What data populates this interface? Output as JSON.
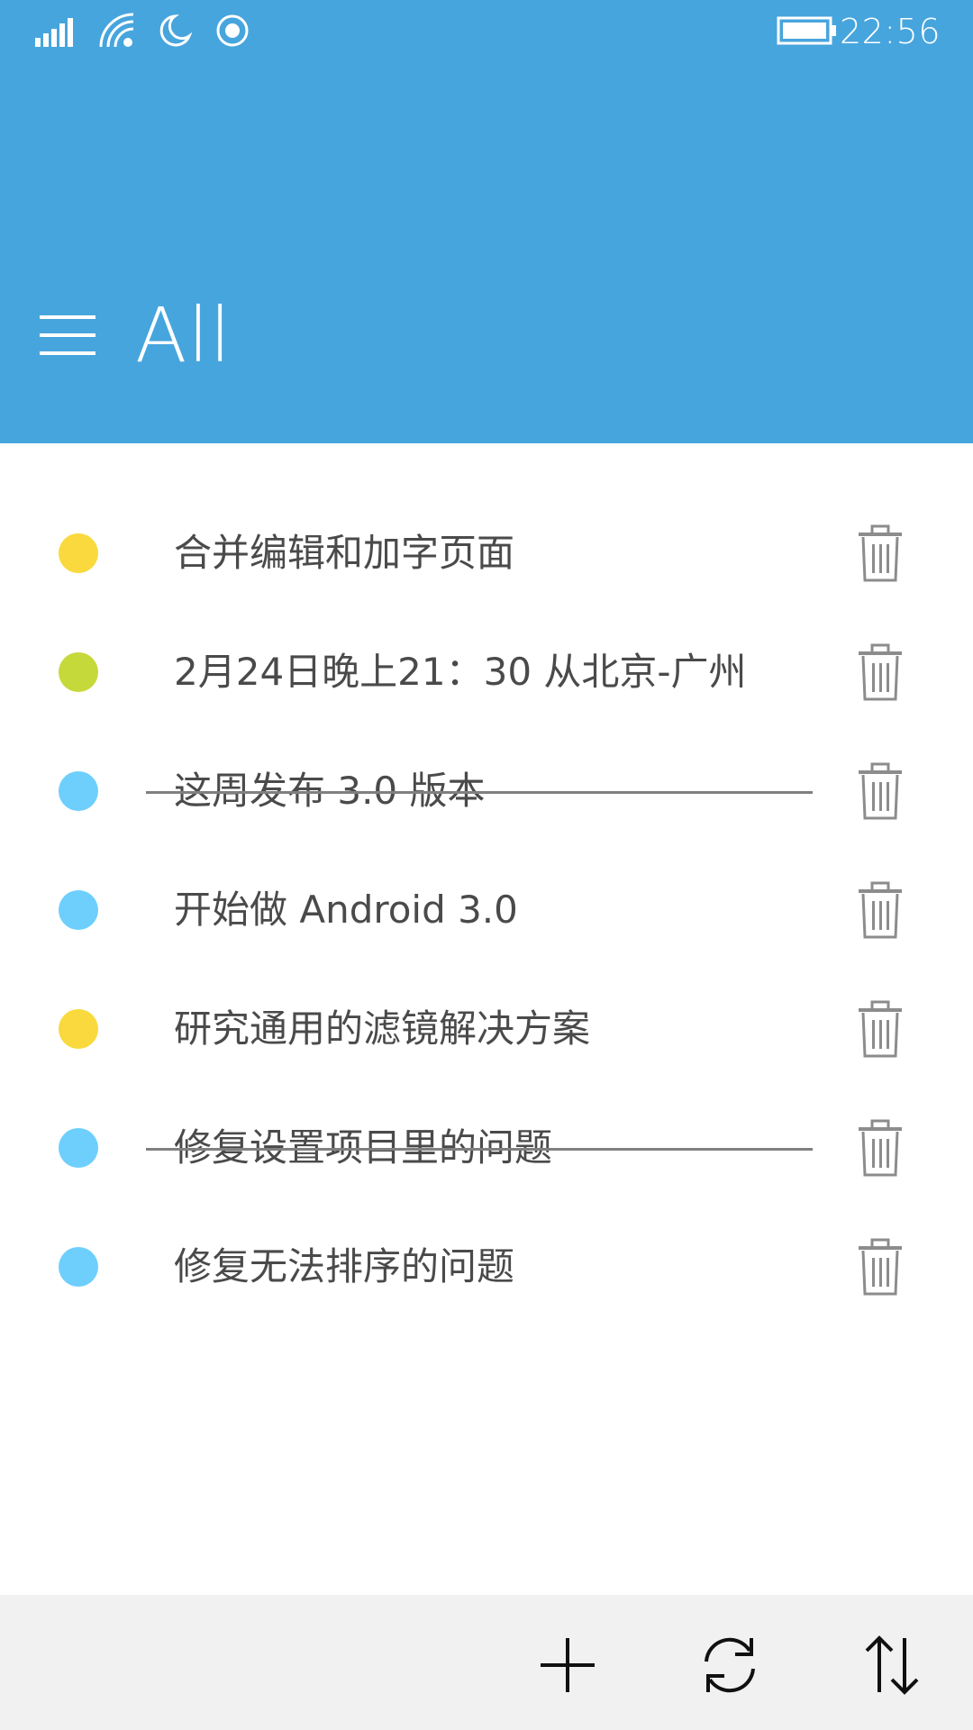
{
  "status_bar": {
    "time": "22:56",
    "icons": [
      "signal-icon",
      "wifi-icon",
      "quiet-hours-moon-icon",
      "location-icon",
      "battery-icon"
    ]
  },
  "header": {
    "title": "All",
    "menu_icon": "hamburger-menu-icon",
    "background_color": "#47a5dd"
  },
  "tasks": [
    {
      "text": "合并编辑和加字页面",
      "color": "#f9d93d",
      "completed": false
    },
    {
      "text": "2月24日晚上21：30 从北京-广州",
      "color": "#c6d93a",
      "completed": false
    },
    {
      "text": "这周发布 3.0 版本",
      "color": "#6ecffd",
      "completed": true
    },
    {
      "text": "开始做 Android 3.0",
      "color": "#6ecffd",
      "completed": false
    },
    {
      "text": "研究通用的滤镜解决方案",
      "color": "#f9d93d",
      "completed": false
    },
    {
      "text": "修复设置项目里的问题",
      "color": "#6ecffd",
      "completed": true
    },
    {
      "text": "修复无法排序的问题",
      "color": "#6ecffd",
      "completed": false
    }
  ],
  "app_bar": {
    "buttons": [
      "add-icon",
      "sync-icon",
      "sort-icon"
    ],
    "background_color": "#f1f1f1"
  }
}
